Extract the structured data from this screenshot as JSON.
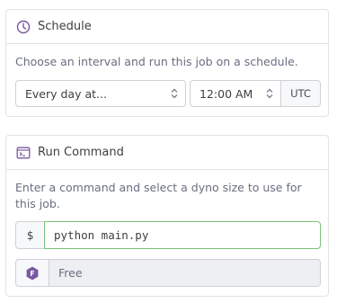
{
  "schedule": {
    "title": "Schedule",
    "icon": "clock-icon",
    "description": "Choose an interval and run this job on a schedule.",
    "interval_value": "Every day at...",
    "time_value": "12:00 AM",
    "timezone": "UTC"
  },
  "run_command": {
    "title": "Run Command",
    "icon": "terminal-icon",
    "description": "Enter a command and select a dyno size to use for this job.",
    "prompt_symbol": "$",
    "command_value": "python main.py",
    "dyno_size": "Free",
    "dyno_badge_letter": "F",
    "dyno_icon": "free-dyno-icon"
  },
  "colors": {
    "accent": "#79589f",
    "input_focus_border": "#79c279",
    "text": "#3f3f44",
    "muted_text": "#6a6d80"
  }
}
